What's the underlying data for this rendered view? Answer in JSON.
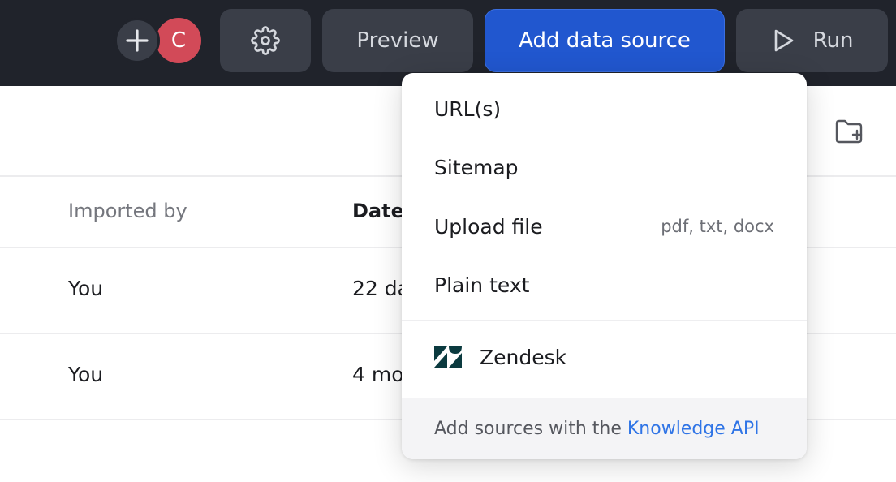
{
  "header": {
    "avatar_initial": "C",
    "preview_label": "Preview",
    "add_source_label": "Add data source",
    "run_label": "Run"
  },
  "table": {
    "columns": [
      "Imported by",
      "Date"
    ],
    "rows": [
      {
        "imported_by": "You",
        "date": "22 da"
      },
      {
        "imported_by": "You",
        "date": "4 mo"
      }
    ]
  },
  "dropdown": {
    "items": [
      {
        "label": "URL(s)",
        "hint": ""
      },
      {
        "label": "Sitemap",
        "hint": ""
      },
      {
        "label": "Upload file",
        "hint": "pdf, txt, docx"
      },
      {
        "label": "Plain text",
        "hint": ""
      }
    ],
    "integration": {
      "label": "Zendesk",
      "icon": "zendesk-icon"
    },
    "footer_text": "Add sources with the",
    "footer_link": "Knowledge API"
  },
  "colors": {
    "topbar": "#20232b",
    "primary": "#2157cf",
    "avatar": "#d24a58",
    "link": "#2f74e6"
  }
}
